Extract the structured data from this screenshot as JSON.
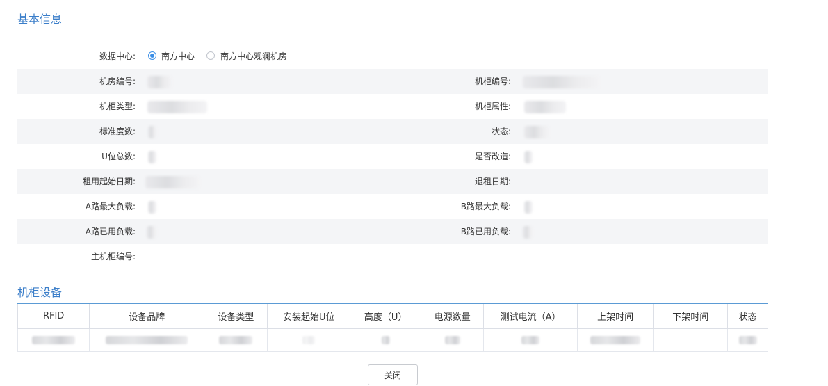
{
  "basic_info": {
    "title": "基本信息",
    "datacenter": {
      "label": "数据中心:",
      "options": [
        {
          "label": "南方中心",
          "checked": true
        },
        {
          "label": "南方中心观澜机房",
          "checked": false
        }
      ]
    },
    "fields": {
      "room_no": "机房编号:",
      "cabinet_no": "机柜编号:",
      "cabinet_type": "机柜类型:",
      "cabinet_attr": "机柜属性:",
      "standard_power": "标准度数:",
      "status": "状态:",
      "u_total": "U位总数:",
      "retrofitted": "是否改造:",
      "lease_start": "租用起始日期:",
      "lease_end": "退租日期:",
      "a_max_load": "A路最大负载:",
      "b_max_load": "B路最大负载:",
      "a_used_load": "A路已用负载:",
      "b_used_load": "B路已用负载:",
      "host_cabinet_no": "主机柜编号:"
    }
  },
  "devices": {
    "title": "机柜设备",
    "columns": [
      "RFID",
      "设备品牌",
      "设备类型",
      "安装起始U位",
      "高度（U）",
      "电源数量",
      "测试电流（A）",
      "上架时间",
      "下架时间",
      "状态"
    ]
  },
  "footer": {
    "close_label": "关闭"
  }
}
